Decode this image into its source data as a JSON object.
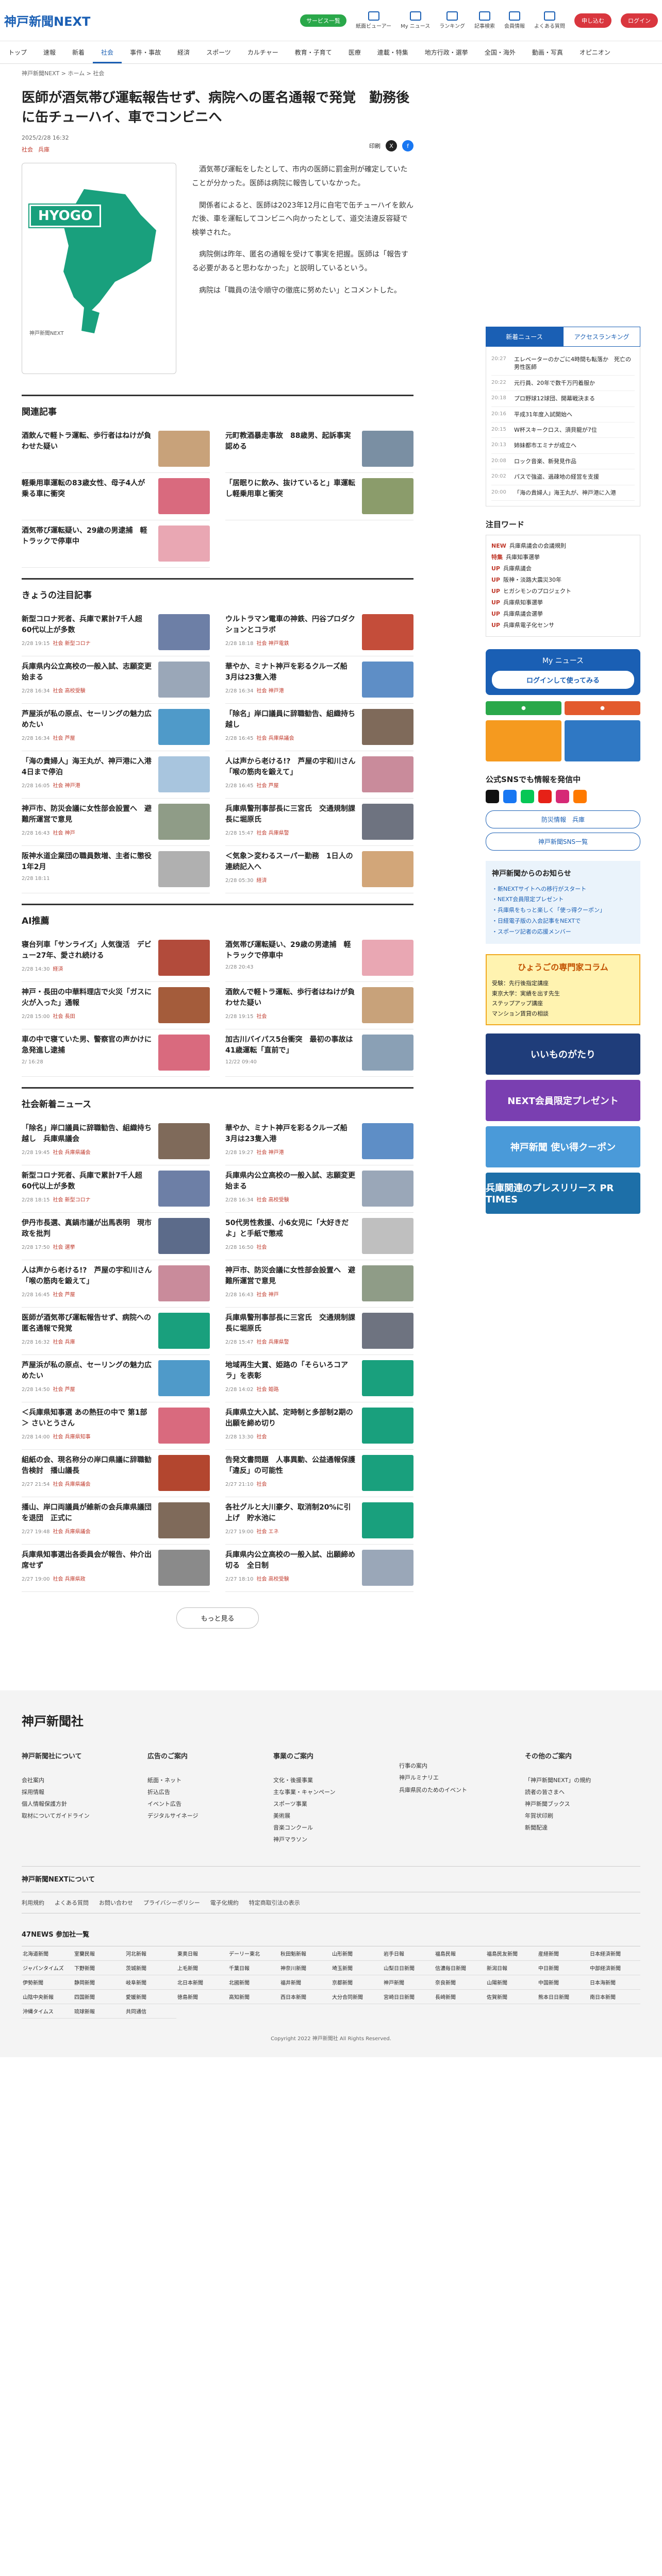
{
  "header": {
    "logo_main": "神戸新聞",
    "logo_sub": "NEXT",
    "service_pill": "サービス一覧",
    "icons": [
      {
        "label": "紙面ビューアー",
        "icon": "newspaper-icon"
      },
      {
        "label": "My ニュース",
        "icon": "star-icon"
      },
      {
        "label": "ランキング",
        "icon": "crown-icon"
      },
      {
        "label": "記事検索",
        "icon": "search-icon"
      },
      {
        "label": "会員情報",
        "icon": "user-icon"
      },
      {
        "label": "よくある質問",
        "icon": "question-icon"
      }
    ],
    "signup": "申し込む",
    "login": "ログイン"
  },
  "nav": [
    "トップ",
    "速報",
    "新着",
    "社会",
    "事件・事故",
    "経済",
    "スポーツ",
    "カルチャー",
    "教育・子育て",
    "医療",
    "連載・特集",
    "地方行政・選挙",
    "全国・海外",
    "動画・写真",
    "オピニオン"
  ],
  "nav_active": "社会",
  "breadcrumb": "神戸新聞NEXT > ホーム > 社会",
  "article": {
    "title": "医師が酒気帯び運転報告せず、病院への匿名通報で発覚　勤務後に缶チューハイ、車でコンビニへ",
    "date": "2025/2/28 16:32",
    "tags": [
      "社会",
      "兵庫"
    ],
    "print": "印刷",
    "map_label": "HYOGO",
    "map_credit": "神戸新聞NEXT",
    "paragraphs": [
      "酒気帯び運転をしたとして、市内の医師に罰金刑が確定していたことが分かった。医師は病院に報告していなかった。",
      "関係者によると、医師は2023年12月に自宅で缶チューハイを飲んだ後、車を運転してコンビニへ向かったとして、道交法違反容疑で検挙された。",
      "病院側は昨年、匿名の通報を受けて事実を把握。医師は「報告する必要があると思わなかった」と説明しているという。",
      "病院は「職員の法令順守の徹底に努めたい」とコメントした。"
    ]
  },
  "related": {
    "heading": "関連記事",
    "items": [
      {
        "title": "酒飲んで軽トラ運転、歩行者はねけが負わせた疑い",
        "thumb": "#c8a27a"
      },
      {
        "title": "元町教酒暴走事故　88歳男、起訴事実認める",
        "thumb": "#7a8fa3"
      },
      {
        "title": "軽乗用車運転の83歳女性、母子4人が乗る車に衝突",
        "thumb": "#d96a7e"
      },
      {
        "title": "「居眠りに飲み、抜けていると」車運転し軽乗用車と衝突",
        "thumb": "#8b9c6b"
      },
      {
        "title": "酒気帯び運転疑い、29歳の男逮捕　軽トラックで停車中",
        "thumb": "#e9a7b3"
      }
    ]
  },
  "popular": {
    "heading": "きょうの注目記事",
    "items": [
      {
        "title": "新型コロナ死者、兵庫で累計7千人超　60代以上が多数",
        "date": "2/28 19:15",
        "cat": "社会 新型コロナ",
        "thumb": "#6d7fa6"
      },
      {
        "title": "ウルトラマン電車の神鉄、円谷プロダクションとコラボ",
        "date": "2/28 18:18",
        "cat": "社会 神戸電鉄",
        "thumb": "#c44d3a"
      },
      {
        "title": "兵庫県内公立高校の一般入試、志願変更始まる",
        "date": "2/28 16:34",
        "cat": "社会 高校受験",
        "thumb": "#9aa7b8"
      },
      {
        "title": "華やか、ミナト神戸を彩るクルーズ船　3月は23隻入港",
        "date": "2/28 16:34",
        "cat": "社会 神戸港",
        "thumb": "#5e8ec6"
      },
      {
        "title": "芦屋浜が私の原点、セーリングの魅力広めたい",
        "date": "2/28 16:34",
        "cat": "社会 芦屋",
        "thumb": "#4f9ac9"
      },
      {
        "title": "「除名」岸口議員に辞職勧告、組織持ち越し",
        "date": "2/28 16:45",
        "cat": "社会 兵庫県議会",
        "thumb": "#7f6a5a"
      },
      {
        "title": "「海の貴婦人」海王丸が、神戸港に入港　4日まで停泊",
        "date": "2/28 16:05",
        "cat": "社会 神戸港",
        "thumb": "#a8c5de"
      },
      {
        "title": "人は声から老ける!?　芦屋の宇和川さん「喉の筋肉を鍛えて」",
        "date": "2/28 16:45",
        "cat": "社会 芦屋",
        "thumb": "#c98b9b"
      },
      {
        "title": "神戸市、防災会議に女性部会設置へ　避難所運営で意見",
        "date": "2/28 16:43",
        "cat": "社会 神戸",
        "thumb": "#8f9c87"
      },
      {
        "title": "兵庫県警刑事部長に三宮氏　交通規制課長に堀原氏",
        "date": "2/28 15:47",
        "cat": "社会 兵庫県警",
        "thumb": "#6e7380"
      },
      {
        "title": "阪神水道企業団の職員数増、主者に懲役1年2月",
        "date": "2/28 18:11",
        "cat": "",
        "thumb": "#b0b0b0"
      },
      {
        "title": "＜気象＞変わるスーパー勤務　1日人の連続記入へ",
        "date": "2/28 05:30",
        "cat": "経済",
        "thumb": "#d2a679"
      }
    ]
  },
  "ai": {
    "heading": "AI推薦",
    "items": [
      {
        "title": "寝台列車「サンライズ」人気復活　デビュー27年、愛され続ける",
        "date": "2/28 14:30",
        "cat": "経済",
        "thumb": "#b24b3b"
      },
      {
        "title": "酒気帯び運転疑い、29歳の男逮捕　軽トラックで停車中",
        "date": "2/28 20:43",
        "cat": "",
        "thumb": "#e9a7b3"
      },
      {
        "title": "神戸・長田の中華料理店で火災「ガスに火が入った」通報",
        "date": "2/28 15:00",
        "cat": "社会 長田",
        "thumb": "#a45c3b"
      },
      {
        "title": "酒飲んで軽トラ運転、歩行者はねけが負わせた疑い",
        "date": "2/28 19:15",
        "cat": "社会",
        "thumb": "#c8a27a"
      },
      {
        "title": "車の中で寝ていた男、警察官の声かけに急発進し逮捕",
        "date": "2/ 16:28",
        "cat": "",
        "thumb": "#d96a7e"
      },
      {
        "title": "加古川バイパス5台衝突　最初の事故は41歳運転「直前で」",
        "date": "12/22 09:40",
        "cat": "",
        "thumb": "#8aa0b5"
      }
    ]
  },
  "society": {
    "heading": "社会新着ニュース",
    "items": [
      {
        "title": "「除名」岸口議員に辞職勧告、組織持ち越し　兵庫県議会",
        "date": "2/28 19:45",
        "cat": "社会 兵庫県議会",
        "thumb": "#7f6a5a"
      },
      {
        "title": "華やか、ミナト神戸を彩るクルーズ船　3月は23隻入港",
        "date": "2/28 19:27",
        "cat": "社会 神戸港",
        "thumb": "#5e8ec6"
      },
      {
        "title": "新型コロナ死者、兵庫で累計7千人超　60代以上が多数",
        "date": "2/28 18:15",
        "cat": "社会 新型コロナ",
        "thumb": "#6d7fa6"
      },
      {
        "title": "兵庫県内公立高校の一般入試、志願変更始まる",
        "date": "2/28 16:34",
        "cat": "社会 高校受験",
        "thumb": "#9aa7b8"
      },
      {
        "title": "伊丹市長選、真鍋市議が出馬表明　現市政を批判",
        "date": "2/28 17:50",
        "cat": "社会 選挙",
        "thumb": "#5c6b8a"
      },
      {
        "title": "50代男性救援、小6女児に「大好きだよ」と手紙で懲戒",
        "date": "2/28 16:50",
        "cat": "社会",
        "thumb": "#bfbfbf"
      },
      {
        "title": "人は声から老ける!?　芦屋の宇和川さん「喉の筋肉を鍛えて」",
        "date": "2/28 16:45",
        "cat": "社会 芦屋",
        "thumb": "#c98b9b"
      },
      {
        "title": "神戸市、防災会議に女性部会設置へ　避難所運営で意見",
        "date": "2/28 16:43",
        "cat": "社会 神戸",
        "thumb": "#8f9c87"
      },
      {
        "title": "医師が酒気帯び運転報告せず、病院への匿名通報で発覚",
        "date": "2/28 16:32",
        "cat": "社会 兵庫",
        "thumb": "#19a07d"
      },
      {
        "title": "兵庫県警刑事部長に三宮氏　交通規制課長に堀原氏",
        "date": "2/28 15:47",
        "cat": "社会 兵庫県警",
        "thumb": "#6e7380"
      },
      {
        "title": "芦屋浜が私の原点、セーリングの魅力広めたい",
        "date": "2/28 14:50",
        "cat": "社会 芦屋",
        "thumb": "#4f9ac9"
      },
      {
        "title": "地域再生大賞、姫路の「そらいろコアラ」を表彰",
        "date": "2/28 14:02",
        "cat": "社会 姫路",
        "thumb": "#19a07d"
      },
      {
        "title": "＜兵庫県知事選 あの熱狂の中で 第1部＞ さいとうさん",
        "date": "2/28 14:00",
        "cat": "社会 兵庫県知事",
        "thumb": "#d96a7e"
      },
      {
        "title": "兵庫県立大入試、定時制と多部制2期の出願を締め切り",
        "date": "2/28 13:30",
        "cat": "社会",
        "thumb": "#19a07d"
      },
      {
        "title": "組紙の会、現名称分の岸口県議に辞職勧告検討　播山議長",
        "date": "2/27 21:54",
        "cat": "社会 兵庫県議会",
        "thumb": "#b3462f"
      },
      {
        "title": "告発文書問題　人事異動、公益通報保護「違反」の可能性",
        "date": "2/27 21:10",
        "cat": "社会",
        "thumb": "#19a07d"
      },
      {
        "title": "播山、岸口両議員が維新の会兵庫県議団を退団　正式に",
        "date": "2/27 19:48",
        "cat": "社会 兵庫県議会",
        "thumb": "#7f6a5a"
      },
      {
        "title": "各社グルと大川豪夕、取消制20%に引上げ　貯水池に",
        "date": "2/27 19:00",
        "cat": "社会 エネ",
        "thumb": "#19a07d"
      },
      {
        "title": "兵庫県知事選出各委員会が報告、仲介出席せず",
        "date": "2/27 19:00",
        "cat": "社会 兵庫県政",
        "thumb": "#8a8a8a"
      },
      {
        "title": "兵庫県内公立高校の一般入試、出願締め切る　全日制",
        "date": "2/27 18:10",
        "cat": "社会 高校受験",
        "thumb": "#9aa7b8"
      }
    ],
    "more": "もっと見る"
  },
  "sidebar": {
    "tabs": [
      "新着ニュース",
      "アクセスランキング"
    ],
    "rank": [
      {
        "t": "20:27",
        "title": "エレベーターのかごに4時間も転落か　死亡の男性医師"
      },
      {
        "t": "20:22",
        "title": "元行員、20年で数千万円着服か"
      },
      {
        "t": "20:18",
        "title": "プロ野球12球団、開幕戦決まる"
      },
      {
        "t": "20:16",
        "title": "平成31年度入試開始へ"
      },
      {
        "t": "20:15",
        "title": "W杯スキークロス、須貝龍が7位"
      },
      {
        "t": "20:13",
        "title": "姉妹都市エミナが成立へ"
      },
      {
        "t": "20:08",
        "title": "ロック音楽、新発見作品"
      },
      {
        "t": "20:02",
        "title": "パスで強盗、過疎地の経営を支援"
      },
      {
        "t": "20:00",
        "title": "「海の貴婦人」海王丸が、神戸港に入港"
      }
    ],
    "words_heading": "注目ワード",
    "words": [
      {
        "tag": "NEW",
        "text": "兵庫県議会の会議規則"
      },
      {
        "tag": "特集",
        "text": "兵庫知事選挙"
      },
      {
        "tag": "UP",
        "text": "兵庫県議会"
      },
      {
        "tag": "UP",
        "text": "阪神・淡路大震災30年"
      },
      {
        "tag": "UP",
        "text": "ヒガシモンのプロジェクト"
      },
      {
        "tag": "UP",
        "text": "兵庫県知事選挙"
      },
      {
        "tag": "UP",
        "text": "兵庫県議会選挙"
      },
      {
        "tag": "UP",
        "text": "兵庫県電子化センサ"
      }
    ],
    "mynews": "My ニュース",
    "mynews_login": "ログインして使ってみる",
    "sns_heading": "公式SNSでも情報を発信中",
    "sns_btn1": "防災情報　兵庫",
    "sns_btn2": "神戸新聞SNS一覧",
    "notice_heading": "神戸新聞からのお知らせ",
    "notices": [
      "・新NEXTサイトへの移行がスタート",
      "・NEXT会員限定プレゼント",
      "・兵庫県をもっと楽しく「使っ得クーポン」",
      "・日経電子版の入会記事をNEXTで",
      "・スポーツ記者の応援メンバー"
    ],
    "column_heading": "ひょうごの専門家コラム",
    "column_items": [
      "受験：先行後指定講座",
      "東京大学：実績を出す先生",
      "ステップアップ講座",
      "マンション賃貸の相談"
    ],
    "banners": [
      {
        "text": "いいものがたり",
        "color": "#1f3d7a"
      },
      {
        "text": "NEXT会員限定プレゼント",
        "color": "#7a3fb1"
      },
      {
        "text": "神戸新聞 使い得クーポン",
        "color": "#4a9ad9"
      },
      {
        "text": "兵庫関連のプレスリリース PR TIMES",
        "color": "#1d6fa8"
      }
    ]
  },
  "footer": {
    "logo": "神戸新聞社",
    "cols": [
      {
        "h": "神戸新聞社について",
        "items": [
          "会社案内",
          "採用情報",
          "個人情報保護方針",
          "取材についてガイドライン"
        ]
      },
      {
        "h": "広告のご案内",
        "items": [
          "紙面・ネット",
          "折込広告",
          "イベント広告",
          "デジタルサイネージ"
        ]
      },
      {
        "h": "事業のご案内",
        "items": [
          "文化・後援事業",
          "主な事業・キャンペーン",
          "スポーツ事業",
          "美術展",
          "音楽コンクール",
          "神戸マラソン"
        ]
      },
      {
        "h": "",
        "items": [
          "行事の案内",
          "神戸ルミナリエ",
          "兵庫県民のためのイベント"
        ]
      },
      {
        "h": "その他のご案内",
        "items": [
          "「神戸新聞NEXT」の規約",
          "読者の皆さまへ",
          "神戸新聞ブックス",
          "年賀状印刷",
          "新聞配達"
        ]
      }
    ],
    "sub_heading": "神戸新聞NEXTについて",
    "links": [
      "利用規約",
      "よくある質問",
      "お問い合わせ",
      "プライバシーポリシー",
      "電子化規約",
      "特定商取引法の表示"
    ],
    "partners_heading": "47NEWS 参加社一覧",
    "partners": [
      "北海道新聞",
      "室蘭民報",
      "河北新報",
      "東奥日報",
      "デーリー東北",
      "秋田魁新報",
      "山形新聞",
      "岩手日報",
      "福島民報",
      "福島民友新聞",
      "産経新聞",
      "日本経済新聞",
      "ジャパンタイムズ",
      "下野新聞",
      "茨城新聞",
      "上毛新聞",
      "千葉日報",
      "神奈川新聞",
      "埼玉新聞",
      "山梨日日新聞",
      "信濃毎日新聞",
      "新潟日報",
      "中日新聞",
      "中部経済新聞",
      "伊勢新聞",
      "静岡新聞",
      "岐阜新聞",
      "北日本新聞",
      "北國新聞",
      "福井新聞",
      "京都新聞",
      "神戸新聞",
      "奈良新聞",
      "山陽新聞",
      "中国新聞",
      "日本海新聞",
      "山陰中央新報",
      "四国新聞",
      "愛媛新聞",
      "徳島新聞",
      "高知新聞",
      "西日本新聞",
      "大分合同新聞",
      "宮崎日日新聞",
      "長崎新聞",
      "佐賀新聞",
      "熊本日日新聞",
      "南日本新聞",
      "沖縄タイムス",
      "琉球新報",
      "共同通信"
    ],
    "copyright": "Copyright 2022 神戸新聞社 All Rights Reserved."
  }
}
